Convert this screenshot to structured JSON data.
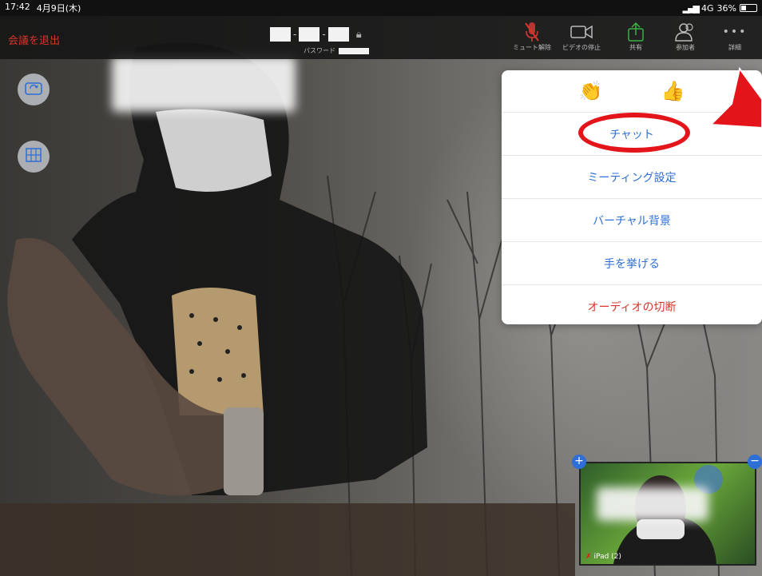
{
  "status_bar": {
    "time": "17:42",
    "date": "4月9日(木)",
    "network": "4G",
    "battery": "36%",
    "battery_level": 0.36
  },
  "toolbar": {
    "leave_label": "会議を退出",
    "password_label": "パスワード",
    "buttons": [
      {
        "icon": "mic-muted-icon",
        "label": "ミュート解除"
      },
      {
        "icon": "video-camera-icon",
        "label": "ビデオの停止"
      },
      {
        "icon": "share-icon",
        "label": "共有"
      },
      {
        "icon": "participants-icon",
        "label": "参加者"
      },
      {
        "icon": "more-icon",
        "label": "詳細"
      }
    ]
  },
  "menu": {
    "reactions": [
      "clap-emoji",
      "thumbs-up-emoji"
    ],
    "items": [
      {
        "label": "チャット",
        "highlighted": true
      },
      {
        "label": "ミーティング設定"
      },
      {
        "label": "バーチャル背景"
      },
      {
        "label": "手を挙げる"
      },
      {
        "label": "オーディオの切断",
        "danger": true
      }
    ]
  },
  "self_view": {
    "label": "iPad (2)"
  },
  "colors": {
    "accent": "#2d6fd6",
    "danger": "#d9342b",
    "annotation": "#e3151a",
    "share_green": "#3cb043"
  }
}
